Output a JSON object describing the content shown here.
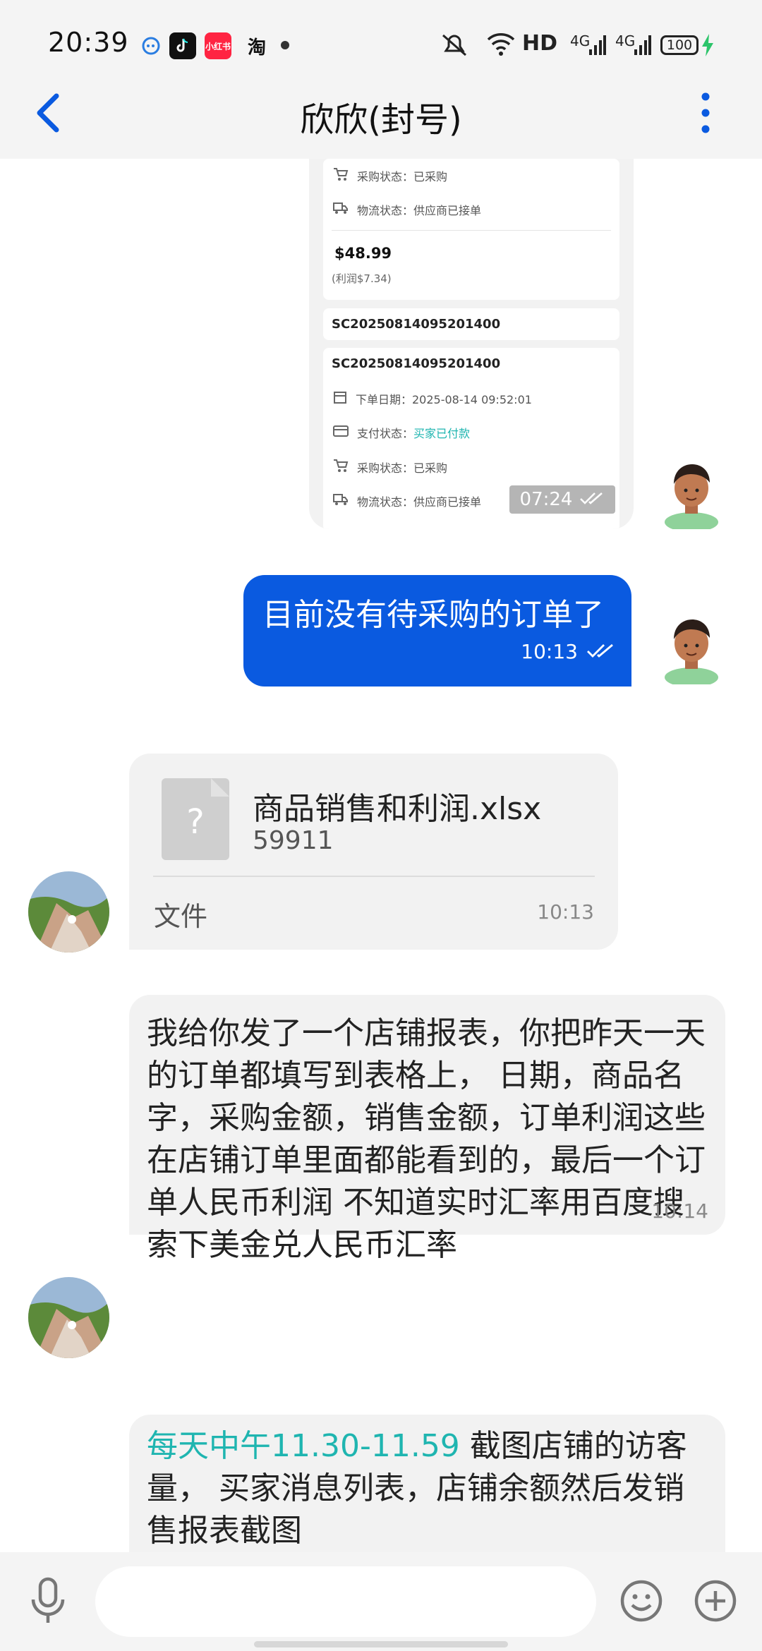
{
  "status_bar": {
    "time": "20:39",
    "apps": [
      "小红书",
      "淘"
    ],
    "network": "HD",
    "signal1": "4G",
    "signal2": "4G",
    "battery": "100"
  },
  "header": {
    "title": "欣欣(封号)"
  },
  "screenshot": {
    "card1": {
      "purchase_status": "采购状态：已采购",
      "logistics_status": "物流状态：供应商已接单",
      "price": "$48.99",
      "profit": "(利润$7.34)"
    },
    "card2": {
      "order_no": "SC20250814095201400"
    },
    "card3": {
      "order_no": "SC20250814095201400",
      "order_date": "下单日期：2025-08-14 09:52:01",
      "pay_label": "支付状态：",
      "pay_value": "买家已付款",
      "purchase_status": "采购状态：已采购",
      "logistics_status": "物流状态：供应商已接单"
    },
    "time": "07:24"
  },
  "messages": {
    "sent1": {
      "text": "目前没有待采购的订单了",
      "time": "10:13"
    },
    "file1": {
      "name": "商品销售和利润.xlsx",
      "size": "59911",
      "label": "文件",
      "time": "10:13"
    },
    "text1": {
      "text": "我给你发了一个店铺报表，你把昨天一天的订单都填写到表格上， 日期，商品名字，采购金额，销售金额，订单利润这些在店铺订单里面都能看到的，最后一个订单人民币利润 不知道实时汇率用百度搜索下美金兑人民币汇率",
      "time": "10:14"
    },
    "text2": {
      "highlight": "每天中午11.30-11.59",
      "text": " 截图店铺的访客量， 买家消息列表，店铺余额然后发销售报表截图"
    }
  },
  "colors": {
    "accent": "#0a5ae0",
    "highlight": "#1fb5b0",
    "bubble_gray": "#f2f2f2"
  }
}
